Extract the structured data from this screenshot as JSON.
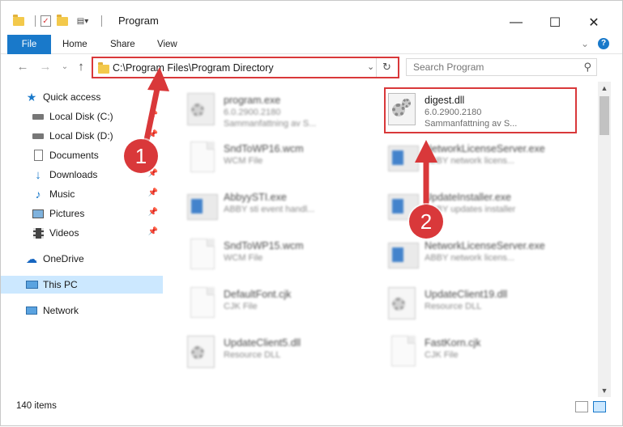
{
  "window": {
    "title": "Program",
    "controls": {
      "minimize": "—",
      "maximize": "☐",
      "close": "✕"
    }
  },
  "ribbon": {
    "tabs": [
      "File",
      "Home",
      "Share",
      "View"
    ],
    "expand_icon": "chevron-down-icon",
    "help_label": "?"
  },
  "address": {
    "path": "C:\\Program Files\\Program Directory",
    "dropdown_glyph": "⌄",
    "refresh_glyph": "↻"
  },
  "search": {
    "placeholder": "Search Program",
    "icon": "⚲"
  },
  "nav": {
    "back": "←",
    "forward": "→",
    "recent": "⌄",
    "up": "↑"
  },
  "sidebar": {
    "items": [
      {
        "label": "Quick access",
        "icon": "star-icon",
        "pinned": false
      },
      {
        "label": "Local Disk (C:)",
        "icon": "drive-icon",
        "pinned": true
      },
      {
        "label": "Local Disk (D:)",
        "icon": "drive-icon",
        "pinned": true
      },
      {
        "label": "Documents",
        "icon": "documents-icon",
        "pinned": true
      },
      {
        "label": "Downloads",
        "icon": "downloads-icon",
        "pinned": true
      },
      {
        "label": "Music",
        "icon": "music-icon",
        "pinned": true
      },
      {
        "label": "Pictures",
        "icon": "pictures-icon",
        "pinned": true
      },
      {
        "label": "Videos",
        "icon": "videos-icon",
        "pinned": true
      },
      {
        "label": "OneDrive",
        "icon": "cloud-icon",
        "pinned": false
      },
      {
        "label": "This PC",
        "icon": "computer-icon",
        "pinned": false,
        "selected": true
      },
      {
        "label": "Network",
        "icon": "network-icon",
        "pinned": false
      }
    ]
  },
  "files": [
    {
      "name": "program.exe",
      "line2": "6.0.2900.2180",
      "line3": "Sammanfattning av S...",
      "type": "app-exe"
    },
    {
      "name": "digest.dll",
      "line2": "6.0.2900.2180",
      "line3": "Sammanfattning av S...",
      "type": "dll"
    },
    {
      "name": "SndToWP16.wcm",
      "line2": "WCM File",
      "type": "doc"
    },
    {
      "name": "NetworkLicenseServer.exe",
      "line2": "ABBY network licens...",
      "type": "app"
    },
    {
      "name": "AbbyySTI.exe",
      "line2": "ABBY sti event handl...",
      "type": "app"
    },
    {
      "name": "UpdateInstaller.exe",
      "line2": "ABBY updates installer",
      "type": "app"
    },
    {
      "name": "SndToWP15.wcm",
      "line2": "WCM File",
      "type": "doc"
    },
    {
      "name": "NetworkLicenseServer.exe",
      "line2": "ABBY network licens...",
      "type": "app"
    },
    {
      "name": "DefaultFont.cjk",
      "line2": "CJK File",
      "type": "doc"
    },
    {
      "name": "UpdateClient19.dll",
      "line2": "Resource DLL",
      "type": "dll"
    },
    {
      "name": "UpdateClient5.dll",
      "line2": "Resource DLL",
      "type": "dll"
    },
    {
      "name": "FastKorn.cjk",
      "line2": "CJK File",
      "type": "doc"
    }
  ],
  "status": {
    "item_count": "140 items"
  },
  "annotations": {
    "badge1": "1",
    "badge2": "2",
    "color": "#d9383a"
  },
  "colors": {
    "accent": "#1979ca",
    "selection": "#cce8ff",
    "highlight": "#d9383a"
  }
}
